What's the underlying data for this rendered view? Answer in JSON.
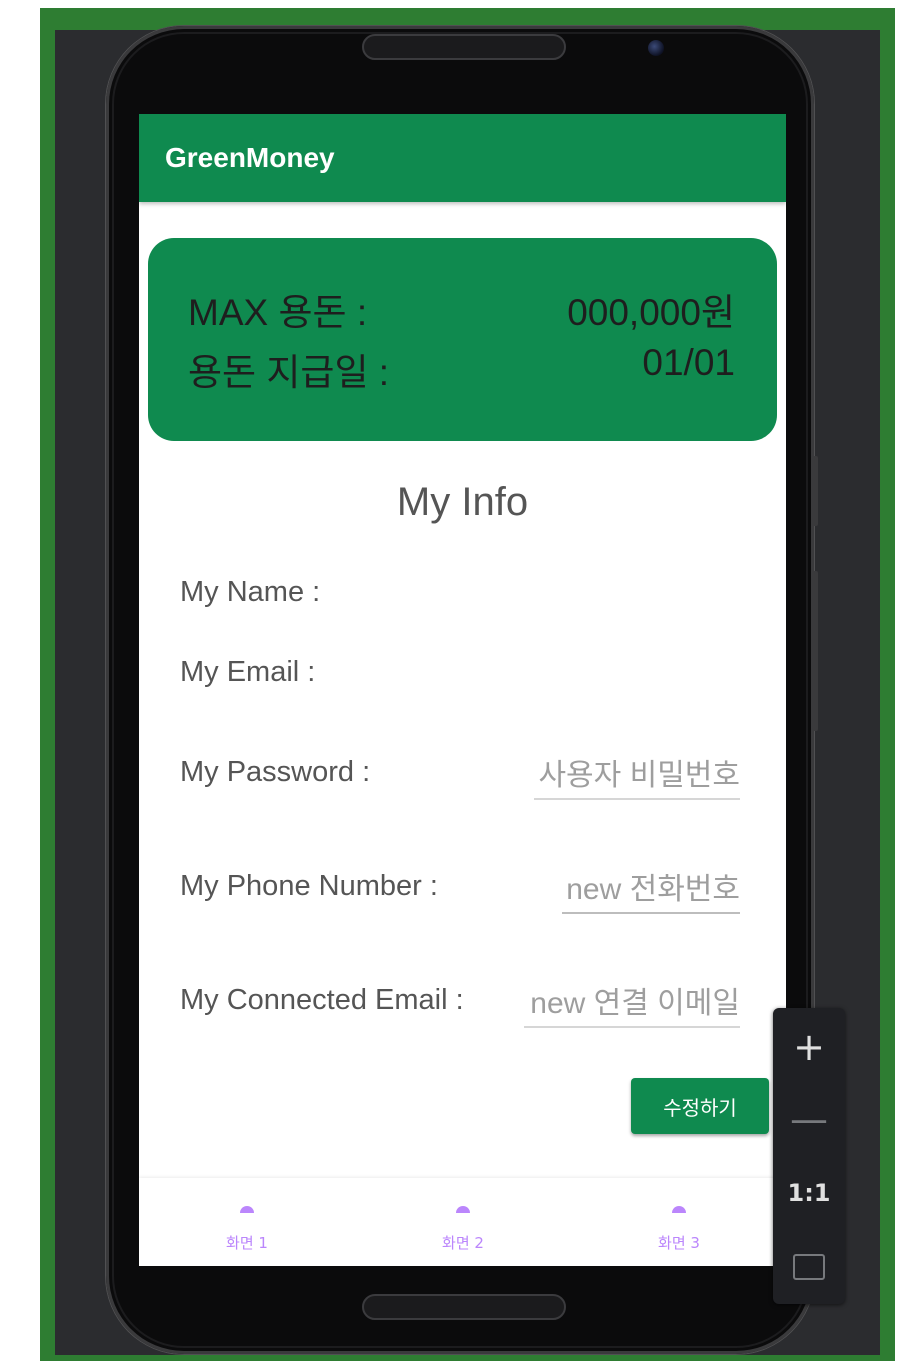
{
  "app": {
    "title": "GreenMoney"
  },
  "summary": {
    "max_allowance_label": "MAX 용돈 :",
    "max_allowance_value": "000,000원",
    "pay_day_label": "용돈 지급일 :",
    "pay_day_value": "01/01"
  },
  "info": {
    "title": "My Info",
    "name_label": "My Name :",
    "email_label": "My Email :",
    "password_label": "My Password :",
    "password_placeholder": "사용자 비밀번호",
    "phone_label": "My Phone Number :",
    "phone_placeholder": "new 전화번호",
    "connected_email_label": "My Connected Email :",
    "connected_email_placeholder": "new 연결 이메일",
    "save_label": "수정하기"
  },
  "bottom_nav": {
    "items": [
      {
        "label": "화면 1",
        "icon": "dot-icon"
      },
      {
        "label": "화면 2",
        "icon": "dot-icon"
      },
      {
        "label": "화면 3",
        "icon": "dot-icon"
      }
    ],
    "accent_color": "#bb86fc"
  },
  "emulator_controls": {
    "zoom_in": "+",
    "zoom_out": "—",
    "actual_size": "1:1"
  },
  "colors": {
    "brand_green": "#0f8a4f",
    "frame_green": "#2e7d32"
  }
}
